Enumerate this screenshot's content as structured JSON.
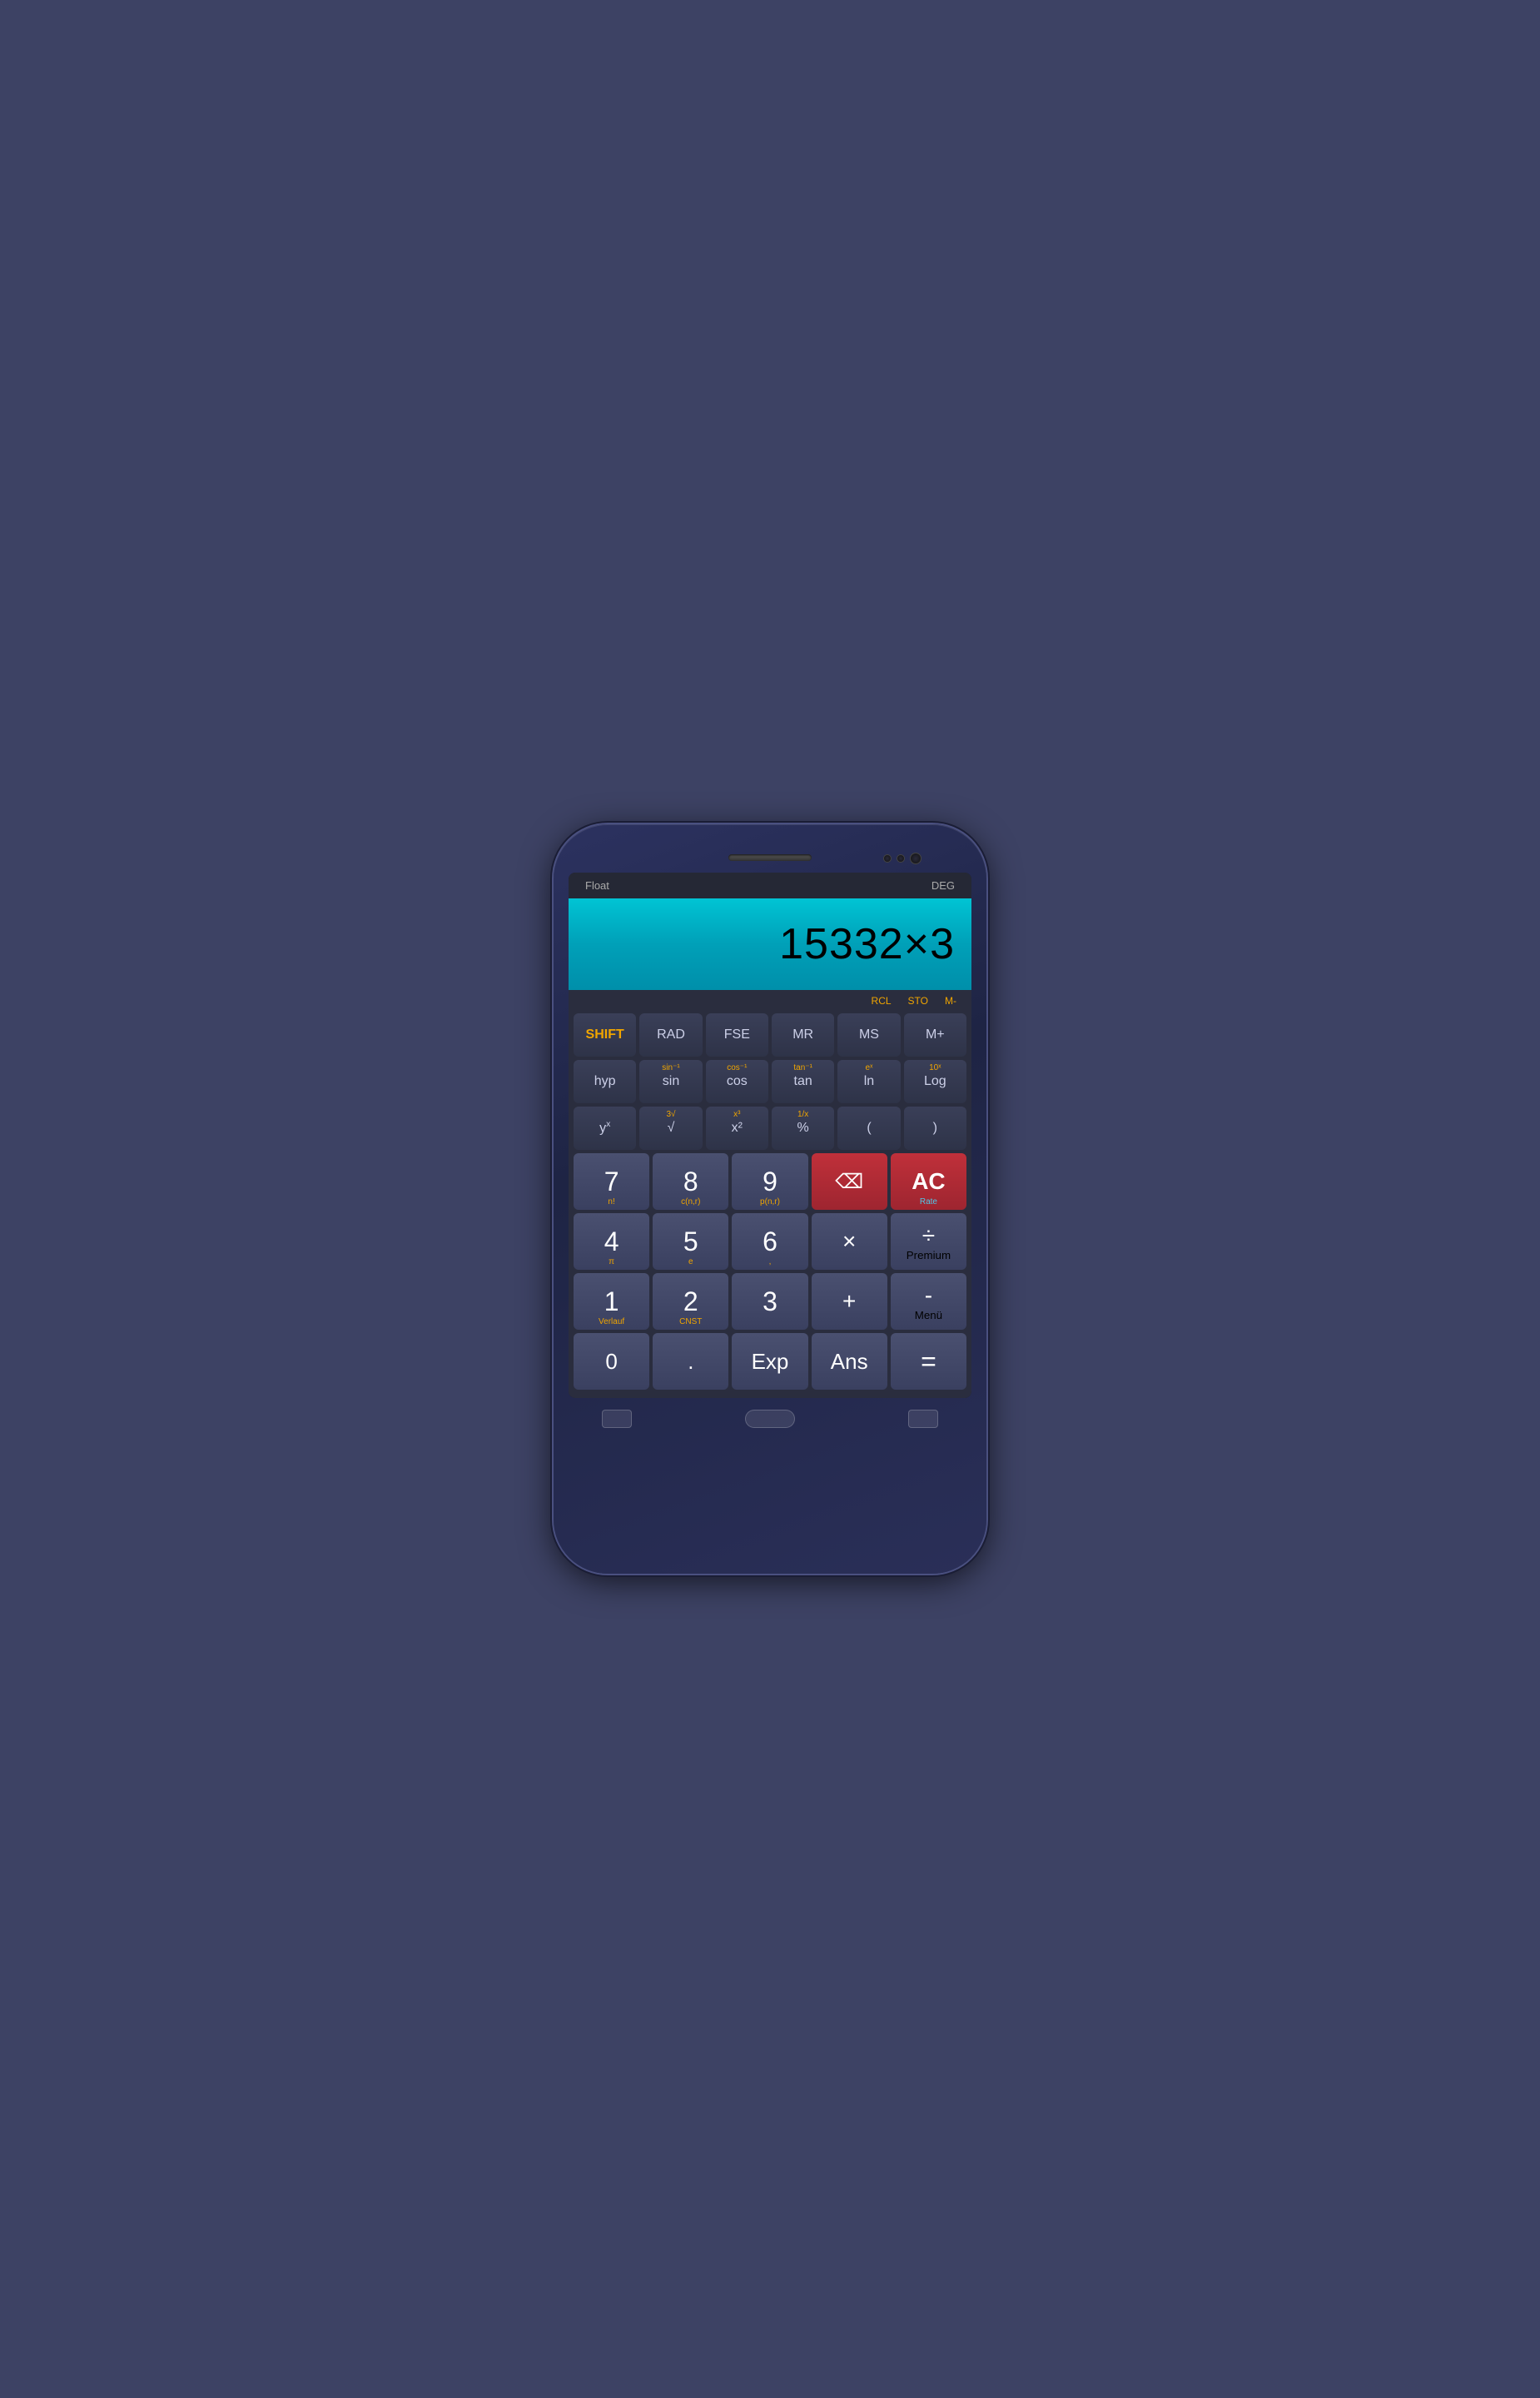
{
  "status": {
    "float_label": "Float",
    "deg_label": "DEG"
  },
  "display": {
    "value": "15332×3"
  },
  "memory_row": {
    "rcl": "RCL",
    "sto": "STO",
    "mminus": "M-"
  },
  "buttons": {
    "row1": [
      {
        "id": "shift",
        "main": "SHIFT",
        "sub": "",
        "type": "shift"
      },
      {
        "id": "rad",
        "main": "RAD",
        "sub": "",
        "type": "sci"
      },
      {
        "id": "fse",
        "main": "FSE",
        "sub": "",
        "type": "sci"
      },
      {
        "id": "mr",
        "main": "MR",
        "sub": "",
        "type": "sci"
      },
      {
        "id": "ms",
        "main": "MS",
        "sub": "",
        "type": "sci"
      },
      {
        "id": "mplus",
        "main": "M+",
        "sub": "",
        "type": "sci"
      }
    ],
    "row2": [
      {
        "id": "hyp",
        "main": "hyp",
        "sub": "",
        "type": "sci"
      },
      {
        "id": "sin",
        "main": "sin",
        "sub": "sin⁻¹",
        "type": "sci"
      },
      {
        "id": "cos",
        "main": "cos",
        "sub": "cos⁻¹",
        "type": "sci"
      },
      {
        "id": "tan",
        "main": "tan",
        "sub": "tan⁻¹",
        "type": "sci"
      },
      {
        "id": "ln",
        "main": "ln",
        "sub": "eˣ",
        "type": "sci"
      },
      {
        "id": "log",
        "main": "Log",
        "sub": "10ˣ",
        "type": "sci"
      }
    ],
    "row3": [
      {
        "id": "yx",
        "main": "yˣ",
        "sub": "",
        "type": "sci"
      },
      {
        "id": "sqrt",
        "main": "√",
        "sub": "3√",
        "type": "sci"
      },
      {
        "id": "x2",
        "main": "x²",
        "sub": "x³",
        "type": "sci"
      },
      {
        "id": "pct",
        "main": "%",
        "sub": "1/x",
        "type": "sci"
      },
      {
        "id": "lparen",
        "main": "(",
        "sub": "",
        "type": "sci"
      },
      {
        "id": "rparen",
        "main": ")",
        "sub": "",
        "type": "sci"
      }
    ],
    "row4": [
      {
        "id": "seven",
        "main": "7",
        "sub": "n!",
        "sub_pos": "bottom",
        "type": "num"
      },
      {
        "id": "eight",
        "main": "8",
        "sub": "c(n,r)",
        "sub_pos": "bottom",
        "type": "num"
      },
      {
        "id": "nine",
        "main": "9",
        "sub": "p(n,r)",
        "sub_pos": "bottom",
        "type": "num"
      },
      {
        "id": "del",
        "main": "⌫",
        "sub": "",
        "type": "del"
      },
      {
        "id": "ac",
        "main": "AC",
        "sub": "Rate",
        "sub_color": "blue",
        "type": "ac"
      }
    ],
    "row5": [
      {
        "id": "four",
        "main": "4",
        "sub": "π",
        "sub_pos": "bottom",
        "type": "num"
      },
      {
        "id": "five",
        "main": "5",
        "sub": "e",
        "sub_pos": "bottom",
        "type": "num"
      },
      {
        "id": "six",
        "main": "6",
        "sub": ",",
        "sub_pos": "bottom",
        "type": "num"
      },
      {
        "id": "mul",
        "main": "×",
        "sub": "",
        "type": "op"
      },
      {
        "id": "div",
        "main": "÷",
        "sub": "Premium",
        "sub_color": "blue",
        "type": "op"
      }
    ],
    "row6": [
      {
        "id": "one",
        "main": "1",
        "sub": "Verlauf",
        "sub_pos": "bottom",
        "type": "num"
      },
      {
        "id": "two",
        "main": "2",
        "sub": "CNST",
        "sub_pos": "bottom",
        "type": "num"
      },
      {
        "id": "three",
        "main": "3",
        "sub": "",
        "type": "num"
      },
      {
        "id": "plus",
        "main": "+",
        "sub": "",
        "type": "op"
      },
      {
        "id": "minus",
        "main": "-",
        "sub": "Menü",
        "sub_color": "blue",
        "type": "op"
      }
    ],
    "row7": [
      {
        "id": "zero",
        "main": "0",
        "sub": "",
        "type": "wide"
      },
      {
        "id": "dot",
        "main": ".",
        "sub": "",
        "type": "wide"
      },
      {
        "id": "exp",
        "main": "Exp",
        "sub": "",
        "type": "wide"
      },
      {
        "id": "ans",
        "main": "Ans",
        "sub": "",
        "type": "wide"
      },
      {
        "id": "equals",
        "main": "=",
        "sub": "",
        "type": "equals"
      }
    ]
  }
}
